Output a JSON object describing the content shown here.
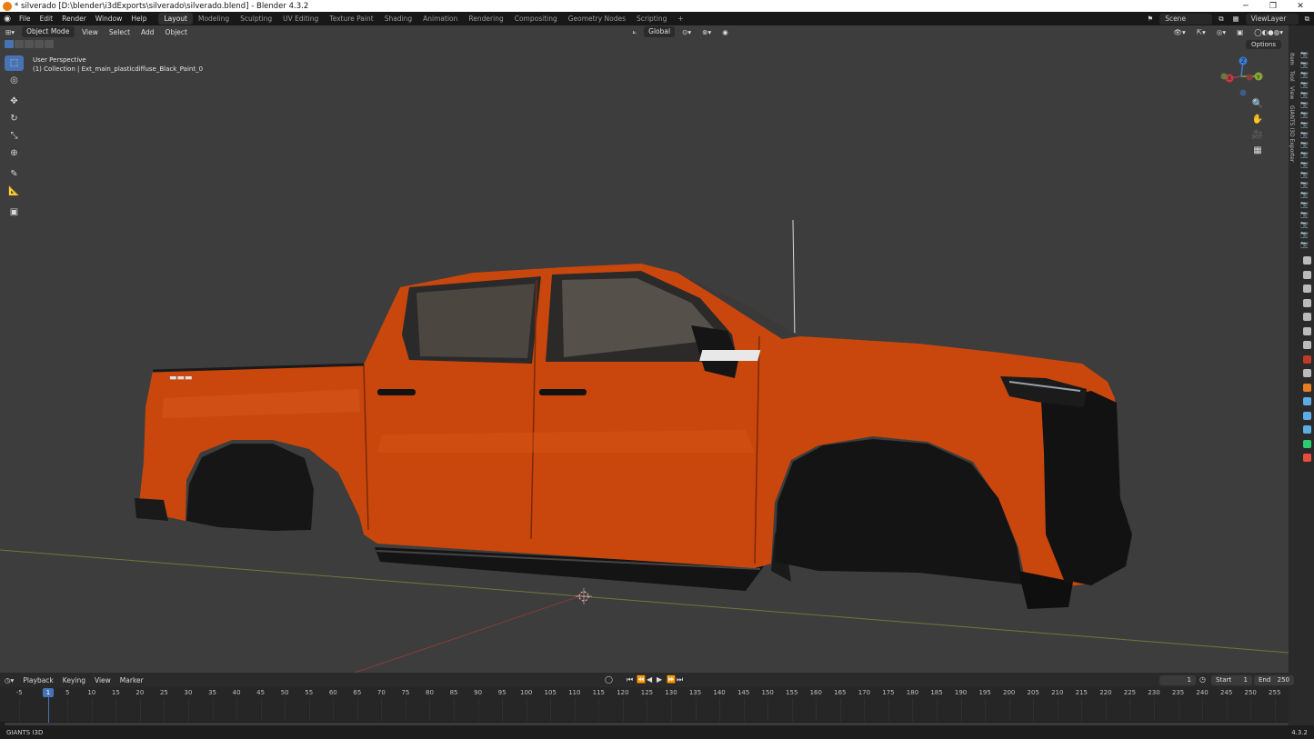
{
  "window": {
    "title": "* silverado [D:\\blender\\i3dExports\\silverado\\silverado.blend] - Blender 4.3.2",
    "minimize": "─",
    "restore": "❐",
    "close": "✕"
  },
  "menubar": {
    "menus": [
      "File",
      "Edit",
      "Render",
      "Window",
      "Help"
    ],
    "workspaces": [
      "Layout",
      "Modeling",
      "Sculpting",
      "UV Editing",
      "Texture Paint",
      "Shading",
      "Animation",
      "Rendering",
      "Compositing",
      "Geometry Nodes",
      "Scripting"
    ],
    "active_workspace": "Layout",
    "add_workspace": "+",
    "scene": "Scene",
    "view_layer": "ViewLayer"
  },
  "viewport_header": {
    "mode": "Object Mode",
    "menus": [
      "View",
      "Select",
      "Add",
      "Object"
    ],
    "orientation": "Global",
    "options": "Options"
  },
  "viewport": {
    "view_name": "User Perspective",
    "collection_info": "(1) Collection | Ext_main_plasticdiffuse_Black_Paint_0",
    "body_color": "#c9470d",
    "badge_text": "Z71",
    "axis_labels": {
      "x": "X",
      "y": "Y",
      "z": "Z"
    }
  },
  "sidebar_tabs": [
    "Item",
    "Tool",
    "View",
    "GIANTS I3D Exporter"
  ],
  "timeline": {
    "menus": [
      "Playback",
      "Keying",
      "View",
      "Marker"
    ],
    "current_frame": "1",
    "start_label": "Start",
    "start": "1",
    "end_label": "End",
    "end": "250",
    "ticks": [
      "-5",
      "5",
      "10",
      "15",
      "20",
      "25",
      "30",
      "35",
      "40",
      "45",
      "50",
      "55",
      "60",
      "65",
      "70",
      "75",
      "80",
      "85",
      "90",
      "95",
      "100",
      "105",
      "110",
      "115",
      "120",
      "125",
      "130",
      "135",
      "140",
      "145",
      "150",
      "155",
      "160",
      "165",
      "170",
      "175",
      "180",
      "185",
      "190",
      "195",
      "200",
      "205",
      "210",
      "215",
      "220",
      "225",
      "230",
      "235",
      "240",
      "245",
      "250",
      "255"
    ]
  },
  "statusbar": {
    "left": "GIANTS I3D",
    "version": "4.3.2"
  }
}
